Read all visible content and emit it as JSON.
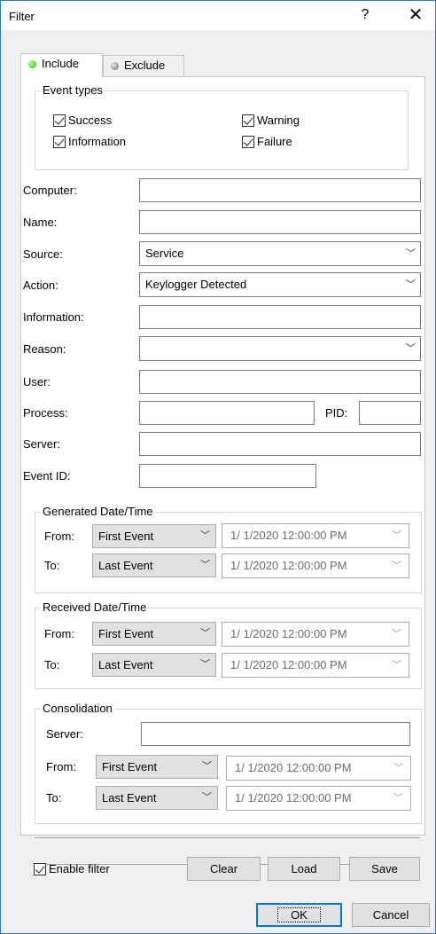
{
  "window": {
    "title": "Filter",
    "help": "?",
    "close": "✕"
  },
  "tabs": [
    {
      "label": "Include"
    },
    {
      "label": "Exclude"
    }
  ],
  "event_types": {
    "title": "Event types",
    "success": "Success",
    "warning": "Warning",
    "information": "Information",
    "failure": "Failure"
  },
  "fields": {
    "computer": "Computer:",
    "name": "Name:",
    "source": "Source:",
    "source_value": "Service",
    "action": "Action:",
    "action_value": "Keylogger Detected",
    "information": "Information:",
    "reason": "Reason:",
    "reason_value": "",
    "user": "User:",
    "process": "Process:",
    "pid": "PID:",
    "server": "Server:",
    "event_id": "Event ID:"
  },
  "generated": {
    "title": "Generated Date/Time",
    "from_label": "From:",
    "from_value": "First Event",
    "from_date": "1/ 1/2020 12:00:00 PM",
    "to_label": "To:",
    "to_value": "Last Event",
    "to_date": "1/ 1/2020 12:00:00 PM"
  },
  "received": {
    "title": "Received Date/Time",
    "from_label": "From:",
    "from_value": "First Event",
    "from_date": "1/ 1/2020 12:00:00 PM",
    "to_label": "To:",
    "to_value": "Last Event",
    "to_date": "1/ 1/2020 12:00:00 PM"
  },
  "consolidation": {
    "title": "Consolidation",
    "server_label": "Server:",
    "from_label": "From:",
    "from_value": "First Event",
    "from_date": "1/ 1/2020 12:00:00 PM",
    "to_label": "To:",
    "to_value": "Last Event",
    "to_date": "1/ 1/2020 12:00:00 PM"
  },
  "footer": {
    "enable_filter": "Enable filter",
    "clear": "Clear",
    "load": "Load",
    "save": "Save"
  },
  "dialog": {
    "ok": "OK",
    "cancel": "Cancel"
  },
  "icons": {
    "chevron": "chevron-down-icon",
    "check": "checkmark-icon"
  },
  "colors": {
    "accent": "#0078d7",
    "include_dot": "#2fb30e"
  }
}
